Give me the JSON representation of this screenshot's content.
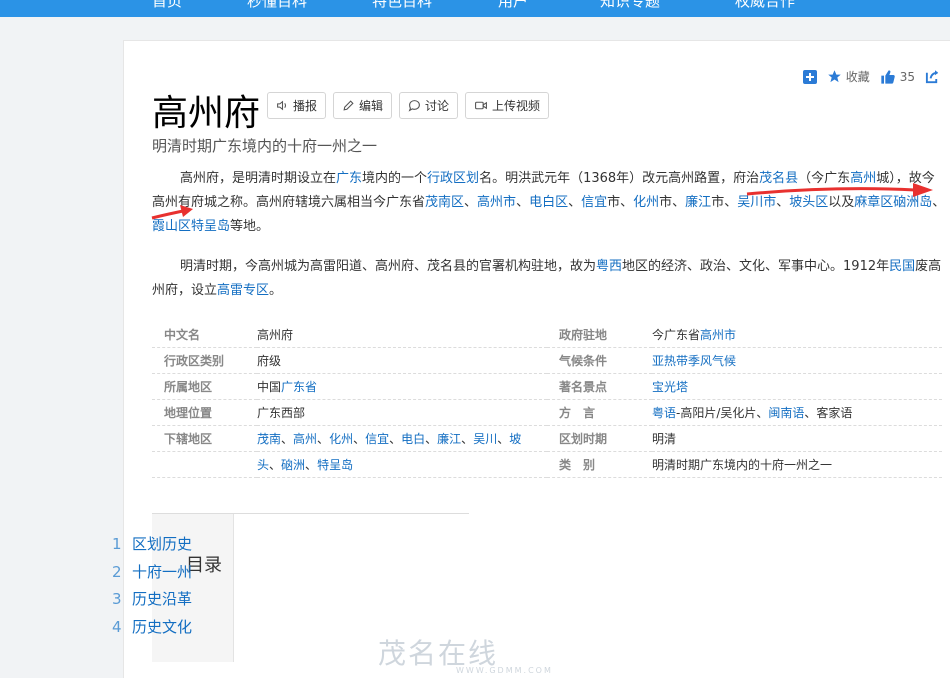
{
  "topnav": [
    "首页",
    "秒懂百科",
    "特色百科",
    "用户",
    "知识专题",
    "权威合作"
  ],
  "toolbar": {
    "collect": "收藏",
    "likes": "35"
  },
  "title": "高州府",
  "buttons": [
    "播报",
    "编辑",
    "讨论",
    "上传视频"
  ],
  "subtitle": "明清时期广东境内的十府一州之一",
  "para1": [
    {
      "t": "高州府，是明清时期设立在"
    },
    {
      "t": "广东",
      "l": 1
    },
    {
      "t": "境内的一个"
    },
    {
      "t": "行政区划",
      "l": 1
    },
    {
      "t": "名。明洪武元年（1368年）改元高州路置，府治"
    },
    {
      "t": "茂名县",
      "l": 1
    },
    {
      "t": "（今广东"
    },
    {
      "t": "高州",
      "l": 1
    },
    {
      "t": "城），故今高州有府城之称。高州府辖境六属相当今广东省"
    },
    {
      "t": "茂南区",
      "l": 1
    },
    {
      "t": "、"
    },
    {
      "t": "高州市",
      "l": 1
    },
    {
      "t": "、"
    },
    {
      "t": "电白区",
      "l": 1
    },
    {
      "t": "、"
    },
    {
      "t": "信宜",
      "l": 1
    },
    {
      "t": "市、"
    },
    {
      "t": "化州",
      "l": 1
    },
    {
      "t": "市、"
    },
    {
      "t": "廉江",
      "l": 1
    },
    {
      "t": "市、"
    },
    {
      "t": "吴川市",
      "l": 1
    },
    {
      "t": "、"
    },
    {
      "t": "坡头区",
      "l": 1
    },
    {
      "t": "以及"
    },
    {
      "t": "麻章区",
      "l": 1
    },
    {
      "t": "硇洲岛",
      "l": 1
    },
    {
      "t": "、"
    },
    {
      "t": "霞山区",
      "l": 1
    },
    {
      "t": "特呈岛",
      "l": 1
    },
    {
      "t": "等地。"
    }
  ],
  "para2": [
    {
      "t": "明清时期，今高州城为高雷阳道、高州府、茂名县的官署机构驻地，故为"
    },
    {
      "t": "粤西",
      "l": 1
    },
    {
      "t": "地区的经济、政治、文化、军事中心。1912年"
    },
    {
      "t": "民国",
      "l": 1
    },
    {
      "t": "废高州府，设立"
    },
    {
      "t": "高雷专区",
      "l": 1
    },
    {
      "t": "。"
    }
  ],
  "infobox": {
    "left": [
      {
        "k": "中文名",
        "v": [
          {
            "t": "高州府"
          }
        ]
      },
      {
        "k": "行政区类别",
        "v": [
          {
            "t": "府级"
          }
        ]
      },
      {
        "k": "所属地区",
        "v": [
          {
            "t": "中国"
          },
          {
            "t": "广东省",
            "l": 1
          }
        ]
      },
      {
        "k": "地理位置",
        "v": [
          {
            "t": "广东西部"
          }
        ]
      },
      {
        "k": "下辖地区",
        "v": [
          {
            "t": "茂南",
            "l": 1
          },
          {
            "t": "、"
          },
          {
            "t": "高州",
            "l": 1
          },
          {
            "t": "、"
          },
          {
            "t": "化州",
            "l": 1
          },
          {
            "t": "、"
          },
          {
            "t": "信宜",
            "l": 1
          },
          {
            "t": "、"
          },
          {
            "t": "电白",
            "l": 1
          },
          {
            "t": "、"
          },
          {
            "t": "廉江",
            "l": 1
          },
          {
            "t": "、"
          },
          {
            "t": "吴川",
            "l": 1
          },
          {
            "t": "、"
          },
          {
            "t": "坡",
            "l": 1
          }
        ]
      },
      {
        "k": "",
        "v": [
          {
            "t": "头",
            "l": 1
          },
          {
            "t": "、"
          },
          {
            "t": "硇洲",
            "l": 1
          },
          {
            "t": "、"
          },
          {
            "t": "特呈岛",
            "l": 1
          }
        ]
      }
    ],
    "right": [
      {
        "k": "政府驻地",
        "v": [
          {
            "t": "今广东省"
          },
          {
            "t": "高州市",
            "l": 1
          }
        ]
      },
      {
        "k": "气候条件",
        "v": [
          {
            "t": "亚热带季风气候",
            "l": 1
          }
        ]
      },
      {
        "k": "著名景点",
        "v": [
          {
            "t": "宝光塔",
            "l": 1
          }
        ]
      },
      {
        "k": "方　言",
        "v": [
          {
            "t": "粤语",
            "l": 1
          },
          {
            "t": "-高阳片/吴化片、"
          },
          {
            "t": "闽南语",
            "l": 1
          },
          {
            "t": "、客家语"
          }
        ]
      },
      {
        "k": "区划时期",
        "v": [
          {
            "t": "明清"
          }
        ]
      },
      {
        "k": "类　别",
        "v": [
          {
            "t": "明清时期广东境内的十府一州之一"
          }
        ]
      }
    ]
  },
  "toc": {
    "title": "目录",
    "items": [
      {
        "num": "1",
        "label": "区划历史"
      },
      {
        "num": "2",
        "label": "十府一州"
      },
      {
        "num": "3",
        "label": "历史沿革"
      },
      {
        "num": "4",
        "label": "历史文化"
      }
    ]
  },
  "watermark": {
    "text": "茂名在线",
    "url": "WWW.GDMM.COM"
  },
  "colors": {
    "nav": "#2b93e6",
    "link": "#136ec2",
    "arrow": "#e8312f"
  }
}
